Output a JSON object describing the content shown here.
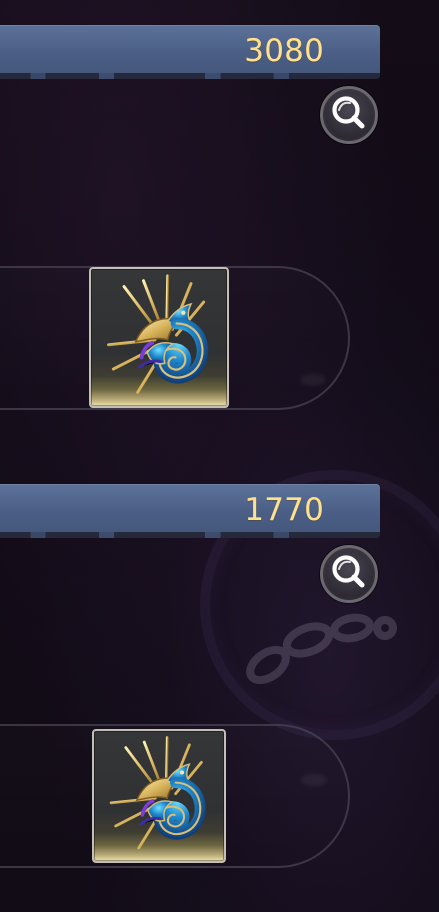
{
  "screen": {
    "entries": [
      {
        "value": "3080",
        "search_icon": "magnifier-icon",
        "reward_icon": "sun-dragon-emblem-icon"
      },
      {
        "value": "1770",
        "search_icon": "magnifier-icon",
        "reward_icon": "sun-dragon-emblem-icon"
      }
    ],
    "colors": {
      "background": "#0f0a13",
      "bar": "#4b5f86",
      "value_text": "#ffe08d",
      "emblem_blue": "#1f87cc",
      "emblem_gold": "#d7b35c"
    }
  }
}
